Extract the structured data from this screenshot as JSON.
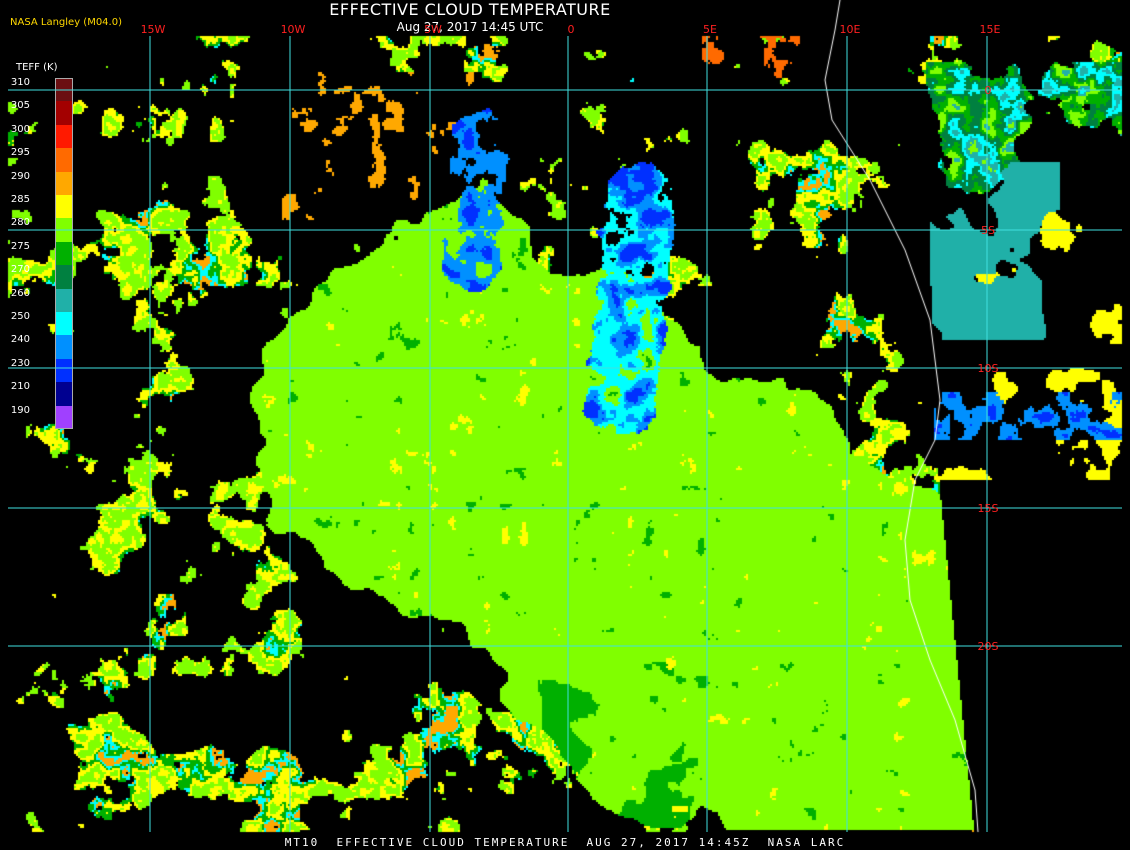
{
  "header": {
    "title": "EFFECTIVE CLOUD TEMPERATURE",
    "subtitle": "Aug 27, 2017 14:45 UTC",
    "credit": "NASA Langley (M04.0)"
  },
  "footer": {
    "text": "MT10  EFFECTIVE CLOUD TEMPERATURE  AUG 27, 2017 14:45Z  NASA LARC"
  },
  "legend": {
    "title": "TEFF (K)",
    "entries": [
      {
        "label": "310",
        "color": "#6b0f12"
      },
      {
        "label": "305",
        "color": "#a30000"
      },
      {
        "label": "300",
        "color": "#ff1a00"
      },
      {
        "label": "295",
        "color": "#ff6a00"
      },
      {
        "label": "290",
        "color": "#ffa800"
      },
      {
        "label": "285",
        "color": "#ffff00"
      },
      {
        "label": "280",
        "color": "#80ff00"
      },
      {
        "label": "275",
        "color": "#00b000"
      },
      {
        "label": "270",
        "color": "#008040"
      },
      {
        "label": "260",
        "color": "#20b0a8"
      },
      {
        "label": "250",
        "color": "#00ffff"
      },
      {
        "label": "240",
        "color": "#0090ff"
      },
      {
        "label": "230",
        "color": "#0030ff"
      },
      {
        "label": "210",
        "color": "#000090"
      },
      {
        "label": "190",
        "color": "#a040ff"
      }
    ]
  },
  "grid": {
    "color": "#40e0e0",
    "label_color": "#ff2020",
    "lon_labels": [
      "15W",
      "10W",
      "5W",
      "0",
      "5E",
      "10E",
      "15E"
    ],
    "lat_labels": [
      "0",
      "5S",
      "10S",
      "15S",
      "20S"
    ]
  }
}
